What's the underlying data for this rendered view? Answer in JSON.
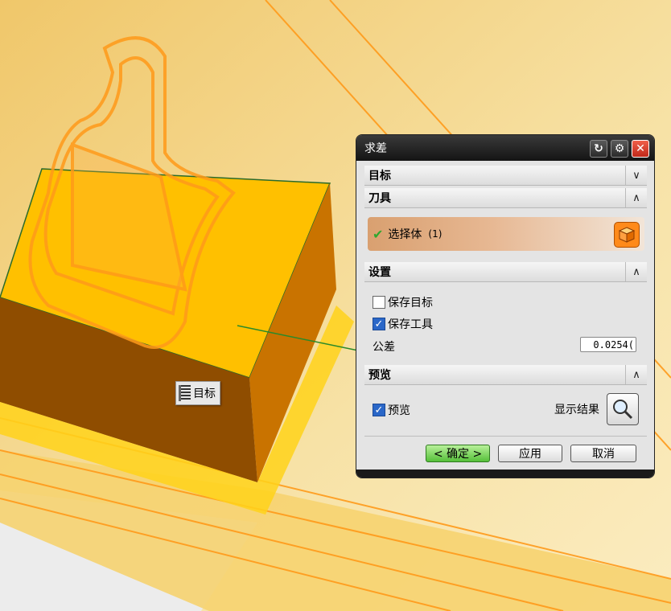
{
  "viewport": {
    "background_color": "#f3d98a",
    "part_color": "#ffc000",
    "edge_color": "#ff9a1a",
    "target_label": "目标"
  },
  "dialog": {
    "title": "求差",
    "title_buttons": [
      "reset-icon",
      "gear-icon",
      "close-icon"
    ],
    "sections": {
      "target": {
        "label": "目标",
        "state": "collapsed"
      },
      "tool": {
        "label": "刀具",
        "state": "expanded",
        "select_body_label": "选择体",
        "select_body_count": "(1)"
      },
      "settings": {
        "label": "设置",
        "state": "expanded",
        "keep_target_label": "保存目标",
        "keep_target_checked": false,
        "keep_tool_label": "保存工具",
        "keep_tool_checked": true,
        "tolerance_label": "公差",
        "tolerance_value": "0.0254("
      },
      "preview": {
        "label": "预览",
        "state": "expanded",
        "preview_label": "预览",
        "preview_checked": true,
        "show_result_label": "显示结果"
      }
    },
    "buttons": {
      "ok": "< 确定 >",
      "apply": "应用",
      "cancel": "取消"
    }
  }
}
